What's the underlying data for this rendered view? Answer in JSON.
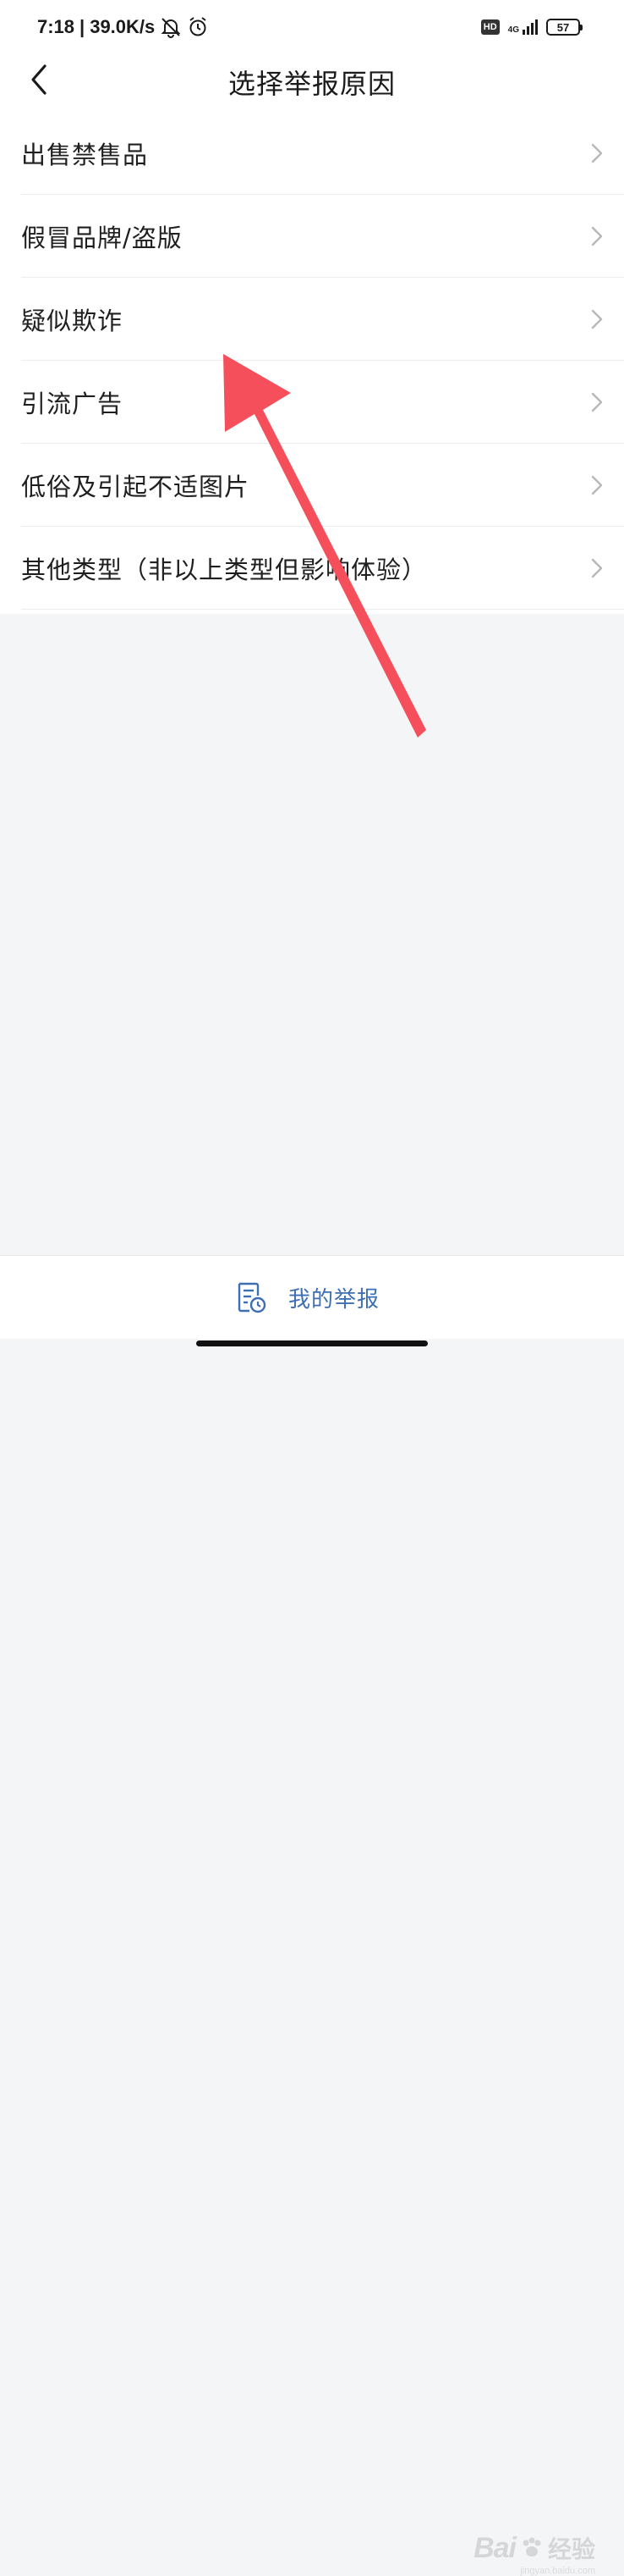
{
  "status_bar": {
    "time": "7:18",
    "separator": "|",
    "net_speed": "39.0K/s",
    "hd_badge": "HD",
    "network": "4G",
    "battery": "57"
  },
  "header": {
    "title": "选择举报原因"
  },
  "reasons": [
    {
      "label": "出售禁售品"
    },
    {
      "label": "假冒品牌/盗版"
    },
    {
      "label": "疑似欺诈"
    },
    {
      "label": "引流广告"
    },
    {
      "label": "低俗及引起不适图片"
    },
    {
      "label": "其他类型（非以上类型但影响体验）"
    }
  ],
  "bottom": {
    "my_report_label": "我的举报"
  },
  "annotation": {
    "arrow_color": "#f54f5c"
  },
  "watermark": {
    "brand": "Bai",
    "brand_cn": "经验",
    "url": "jingyan.baidu.com"
  },
  "colors": {
    "accent_blue": "#3f6fb3",
    "page_bg": "#f4f5f7",
    "card_bg": "#ffffff"
  }
}
